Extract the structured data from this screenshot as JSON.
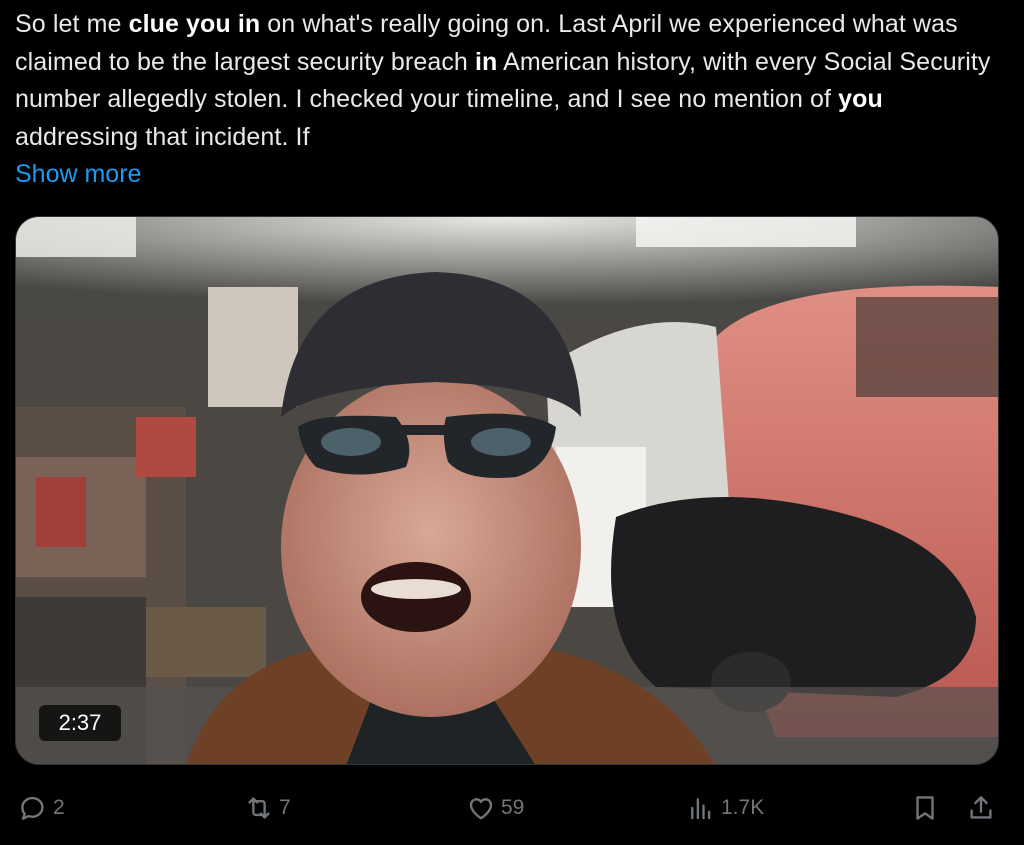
{
  "tweet": {
    "segments": [
      {
        "text": "So let me ",
        "bold": false
      },
      {
        "text": "clue you in",
        "bold": true
      },
      {
        "text": " on what's really going on. Last April we experienced what was claimed to be the largest security breach ",
        "bold": false
      },
      {
        "text": "in",
        "bold": true
      },
      {
        "text": " American history, with every Social Security number allegedly stolen. I checked your timeline, and I see no mention of ",
        "bold": false
      },
      {
        "text": "you",
        "bold": true
      },
      {
        "text": " addressing that incident. If",
        "bold": false
      }
    ],
    "show_more_label": "Show more"
  },
  "media": {
    "type": "video",
    "duration": "2:37"
  },
  "actions": {
    "replies": {
      "icon": "reply-icon",
      "count": "2"
    },
    "reposts": {
      "icon": "repost-icon",
      "count": "7"
    },
    "likes": {
      "icon": "like-icon",
      "count": "59"
    },
    "views": {
      "icon": "views-icon",
      "count": "1.7K"
    },
    "bookmark": {
      "icon": "bookmark-icon"
    },
    "share": {
      "icon": "share-icon"
    }
  },
  "colors": {
    "background": "#000000",
    "text": "#e7e9ea",
    "link": "#1d9bf0",
    "muted": "#71767b"
  }
}
